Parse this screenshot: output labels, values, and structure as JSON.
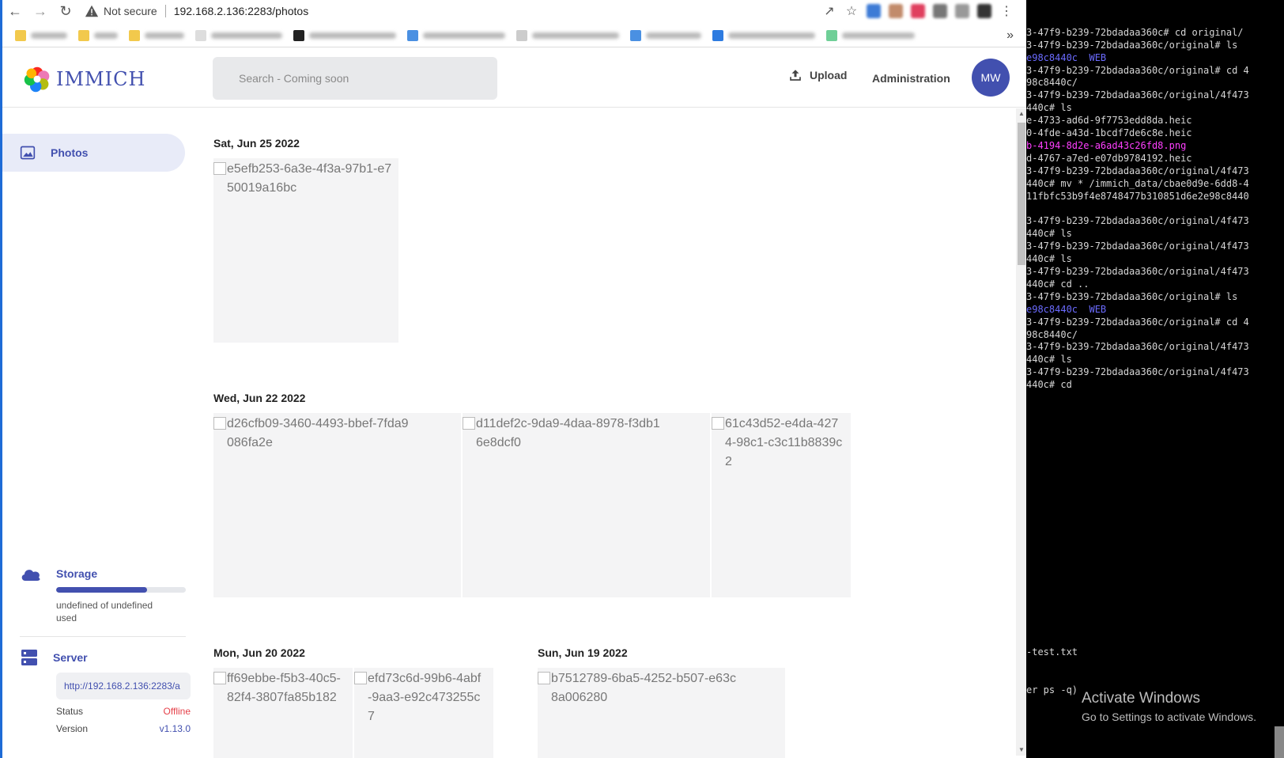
{
  "browser": {
    "security_label": "Not secure",
    "url": "192.168.2.136:2283/photos"
  },
  "app": {
    "logo_text": "IMMICH",
    "search_placeholder": "Search - Coming soon",
    "upload_label": "Upload",
    "admin_label": "Administration",
    "avatar_initials": "MW",
    "accent_color": "#4250af"
  },
  "sidebar": {
    "photos_label": "Photos",
    "storage_label": "Storage",
    "storage_used_text": "undefined of undefined used",
    "storage_fraction": 0.7,
    "server_label": "Server",
    "server_url": "http://192.168.2.136:2283/a",
    "status_label": "Status",
    "status_value": "Offline",
    "version_label": "Version",
    "version_value": "v1.13.0"
  },
  "groups": [
    {
      "date": "Sat, Jun 25 2022",
      "photos": [
        "e5efb253-6a3e-4f3a-97b1-e750019a16bc"
      ]
    },
    {
      "date": "Wed, Jun 22 2022",
      "photos": [
        "d26cfb09-3460-4493-bbef-7fda9086fa2e",
        "d11def2c-9da9-4daa-8978-f3db16e8dcf0",
        "61c43d52-e4da-4274-98c1-c3c11b8839c2"
      ]
    },
    {
      "date": "Mon, Jun 20 2022",
      "photos": [
        "ff69ebbe-f5b3-40c5-82f4-3807fa85b182",
        "efd73c6d-99b6-4abf-9aa3-e92c473255c7"
      ]
    },
    {
      "date": "Sun, Jun 19 2022",
      "photos": [
        "b7512789-6ba5-4252-b507-e63c8a006280"
      ]
    }
  ],
  "terminal": {
    "lines": [
      {
        "t": "3-47f9-b239-72bdadaa360c# cd original/",
        "c": ""
      },
      {
        "t": "3-47f9-b239-72bdadaa360c/original# ls",
        "c": ""
      },
      {
        "t": "e98c8440c  WEB",
        "c": "blue"
      },
      {
        "t": "3-47f9-b239-72bdadaa360c/original# cd 4",
        "c": ""
      },
      {
        "t": "98c8440c/",
        "c": ""
      },
      {
        "t": "3-47f9-b239-72bdadaa360c/original/4f473",
        "c": ""
      },
      {
        "t": "440c# ls",
        "c": ""
      },
      {
        "t": "e-4733-ad6d-9f7753edd8da.heic",
        "c": ""
      },
      {
        "t": "0-4fde-a43d-1bcdf7de6c8e.heic",
        "c": ""
      },
      {
        "t": "b-4194-8d2e-a6ad43c26fd8.png",
        "c": "mag"
      },
      {
        "t": "d-4767-a7ed-e07db9784192.heic",
        "c": ""
      },
      {
        "t": "3-47f9-b239-72bdadaa360c/original/4f473",
        "c": ""
      },
      {
        "t": "440c# mv * /immich_data/cbae0d9e-6dd8-4",
        "c": ""
      },
      {
        "t": "11fbfc53b9f4e8748477b310851d6e2e98c8440",
        "c": ""
      },
      {
        "t": "",
        "c": ""
      },
      {
        "t": "3-47f9-b239-72bdadaa360c/original/4f473",
        "c": ""
      },
      {
        "t": "440c# ls",
        "c": ""
      },
      {
        "t": "3-47f9-b239-72bdadaa360c/original/4f473",
        "c": ""
      },
      {
        "t": "440c# ls",
        "c": ""
      },
      {
        "t": "3-47f9-b239-72bdadaa360c/original/4f473",
        "c": ""
      },
      {
        "t": "440c# cd ..",
        "c": ""
      },
      {
        "t": "3-47f9-b239-72bdadaa360c/original# ls",
        "c": ""
      },
      {
        "t": "e98c8440c  WEB",
        "c": "blue"
      },
      {
        "t": "3-47f9-b239-72bdadaa360c/original# cd 4",
        "c": ""
      },
      {
        "t": "98c8440c/",
        "c": ""
      },
      {
        "t": "3-47f9-b239-72bdadaa360c/original/4f473",
        "c": ""
      },
      {
        "t": "440c# ls",
        "c": ""
      },
      {
        "t": "3-47f9-b239-72bdadaa360c/original/4f473",
        "c": ""
      },
      {
        "t": "440c# cd",
        "c": ""
      }
    ],
    "lower_lines": [
      "-test.txt",
      "er ps -q)"
    ],
    "activate_title": "Activate Windows",
    "activate_sub": "Go to Settings to activate Windows."
  }
}
